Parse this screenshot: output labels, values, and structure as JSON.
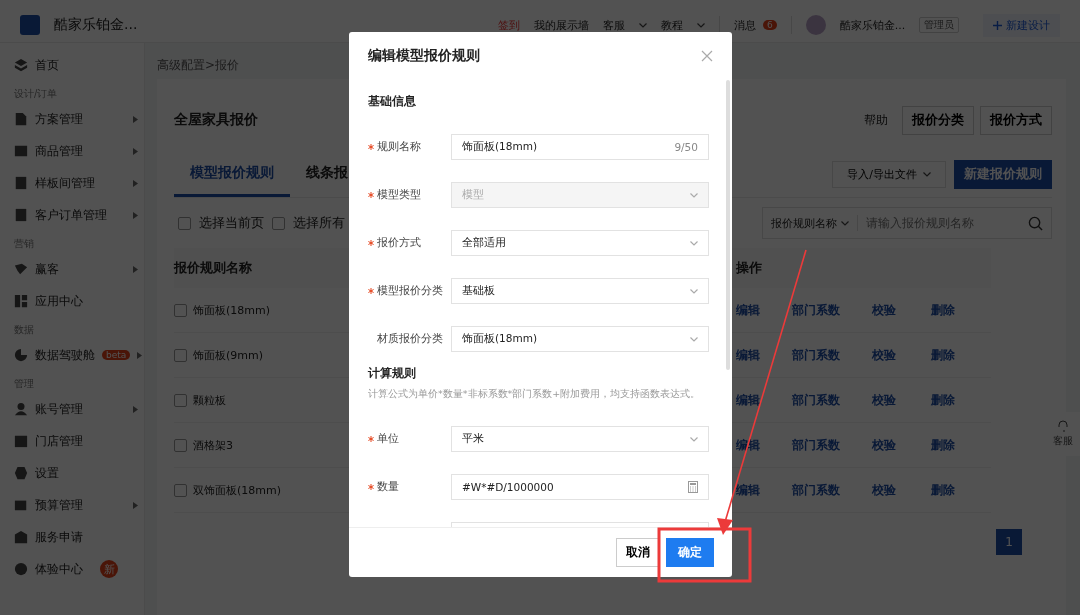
{
  "header": {
    "logo_text": "酷家乐铂金...",
    "nav": [
      {
        "label": "签到",
        "kind": "checkin",
        "dropdown": false
      },
      {
        "label": "我的展示墙",
        "kind": "link",
        "dropdown": false
      },
      {
        "label": "客服",
        "kind": "link",
        "dropdown": true
      },
      {
        "label": "教程",
        "kind": "link",
        "dropdown": true
      }
    ],
    "messages": {
      "label": "消息",
      "badge": "6"
    },
    "user": {
      "name": "酷家乐铂金...",
      "role": "管理员"
    },
    "new_design_button": "新建设计"
  },
  "sidebar": [
    {
      "items": [
        {
          "label": "首页",
          "arrow": false,
          "kind": "plain"
        }
      ]
    },
    {
      "heading": "设计/订单",
      "items": [
        {
          "label": "方案管理",
          "arrow": true,
          "kind": "plain"
        },
        {
          "label": "商品管理",
          "arrow": true,
          "kind": "plain"
        },
        {
          "label": "样板间管理",
          "arrow": true,
          "kind": "plain"
        },
        {
          "label": "客户订单管理",
          "arrow": true,
          "kind": "plain"
        }
      ]
    },
    {
      "heading": "营销",
      "items": [
        {
          "label": "赢客",
          "arrow": true,
          "kind": "plain"
        },
        {
          "label": "应用中心",
          "arrow": false,
          "kind": "plain"
        }
      ]
    },
    {
      "heading": "数据",
      "items": [
        {
          "label": "数据驾驶舱",
          "arrow": true,
          "kind": "pill",
          "badge": "beta"
        }
      ]
    },
    {
      "heading": "管理",
      "items": [
        {
          "label": "账号管理",
          "arrow": true,
          "kind": "plain"
        },
        {
          "label": "门店管理",
          "arrow": false,
          "kind": "plain"
        },
        {
          "label": "设置",
          "arrow": false,
          "kind": "plain"
        },
        {
          "label": "预算管理",
          "arrow": true,
          "kind": "plain"
        },
        {
          "label": "服务申请",
          "arrow": false,
          "kind": "plain"
        },
        {
          "label": "体验中心",
          "arrow": false,
          "kind": "dot",
          "badge": "新"
        }
      ]
    }
  ],
  "main": {
    "breadcrumb": "高级配置>报价",
    "title": "全屋家具报价",
    "help": "帮助",
    "top_buttons": [
      "报价分类",
      "报价方式"
    ],
    "tabs": [
      {
        "label": "模型报价规则",
        "selected": true
      },
      {
        "label": "线条报",
        "selected": false
      }
    ],
    "import_export": "导入/导出文件",
    "new_rule_button": "新建报价规则",
    "select_options": [
      {
        "label": "选择当前页",
        "checked": false
      },
      {
        "label": "选择所有",
        "checked": false
      }
    ],
    "search": {
      "filter": "报价规则名称",
      "placeholder": "请输入报价规则名称"
    },
    "table": {
      "columns": [
        "报价规则名称",
        "操作"
      ],
      "rows": [
        {
          "name": "饰面板(18mm)",
          "checked": false,
          "actions": [
            "编辑",
            "部门系数",
            "校验",
            "删除"
          ]
        },
        {
          "name": "饰面板(9mm)",
          "checked": false,
          "actions": [
            "编辑",
            "部门系数",
            "校验",
            "删除"
          ]
        },
        {
          "name": "颗粒板",
          "checked": false,
          "actions": [
            "编辑",
            "部门系数",
            "校验",
            "删除"
          ]
        },
        {
          "name": "酒格架3",
          "checked": false,
          "actions": [
            "编辑",
            "部门系数",
            "校验",
            "删除"
          ]
        },
        {
          "name": "双饰面板(18mm)",
          "checked": false,
          "actions": [
            "编辑",
            "部门系数",
            "校验",
            "删除"
          ]
        }
      ]
    },
    "pagination": [
      {
        "label": "1",
        "selected": true
      }
    ],
    "service_float": "客服"
  },
  "dialog": {
    "title": "编辑模型报价规则",
    "sections": [
      {
        "heading": "基础信息",
        "fields": [
          {
            "label": "规则名称",
            "required": true,
            "kind": "text",
            "value": "饰面板(18mm)",
            "counter": "9/50",
            "disabled": false
          },
          {
            "label": "模型类型",
            "required": true,
            "kind": "select",
            "value": "模型",
            "disabled": true
          },
          {
            "label": "报价方式",
            "required": true,
            "kind": "select",
            "value": "全部适用",
            "disabled": false
          },
          {
            "label": "模型报价分类",
            "required": true,
            "kind": "select",
            "value": "基础板",
            "disabled": false
          },
          {
            "label": "材质报价分类",
            "required": false,
            "kind": "select",
            "value": "饰面板(18mm)",
            "disabled": false
          }
        ]
      },
      {
        "heading": "计算规则",
        "note": "计算公式为单价*数量*非标系数*部门系数+附加费用，均支持函数表达式。",
        "fields": [
          {
            "label": "单位",
            "required": true,
            "kind": "select",
            "value": "平米",
            "disabled": false
          },
          {
            "label": "数量",
            "required": true,
            "kind": "formula",
            "value": "#W*#D/1000000",
            "disabled": false
          },
          {
            "required": false,
            "kind": "formula"
          }
        ]
      }
    ],
    "buttons": [
      {
        "label": "取消",
        "kind": "secondary"
      },
      {
        "label": "确定",
        "kind": "primary"
      }
    ]
  }
}
